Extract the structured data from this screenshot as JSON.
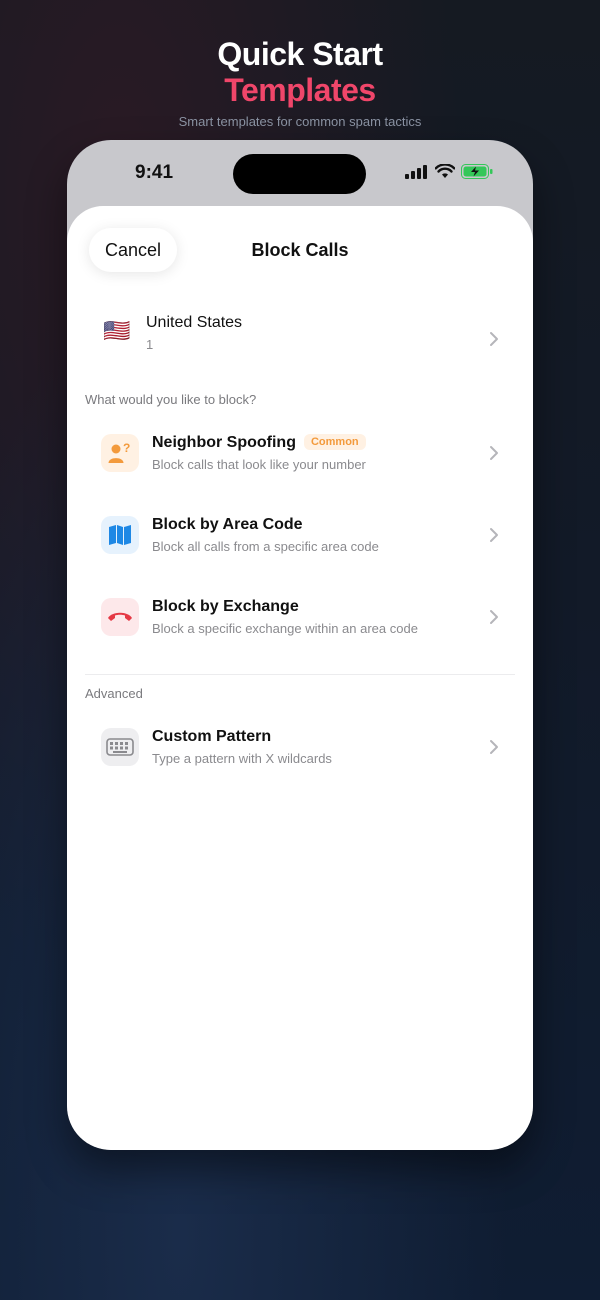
{
  "hero": {
    "title_line1": "Quick Start",
    "title_line2": "Templates",
    "subtitle": "Smart templates for common spam tactics"
  },
  "status_bar": {
    "time": "9:41"
  },
  "sheet": {
    "cancel_label": "Cancel",
    "title": "Block Calls",
    "country": {
      "flag": "🇺🇸",
      "name": "United States",
      "code": "1"
    },
    "block_section_label": "What would you like to block?",
    "options": [
      {
        "label": "Neighbor Spoofing",
        "badge": "Common",
        "description": "Block calls that look like your number",
        "icon": "neighbor-spoofing-icon"
      },
      {
        "label": "Block by Area Code",
        "description": "Block all calls from a specific area code",
        "icon": "map-icon"
      },
      {
        "label": "Block by Exchange",
        "description": "Block a specific exchange within an area code",
        "icon": "hang-up-phone-icon"
      }
    ],
    "advanced_section_label": "Advanced",
    "advanced_options": [
      {
        "label": "Custom Pattern",
        "description": "Type a pattern with X wildcards",
        "icon": "keyboard-icon"
      }
    ]
  },
  "colors": {
    "accent_pink": "#f0466a",
    "badge_orange": "#f39a3c",
    "map_blue": "#1e88e5",
    "hangup_red": "#e53945"
  }
}
